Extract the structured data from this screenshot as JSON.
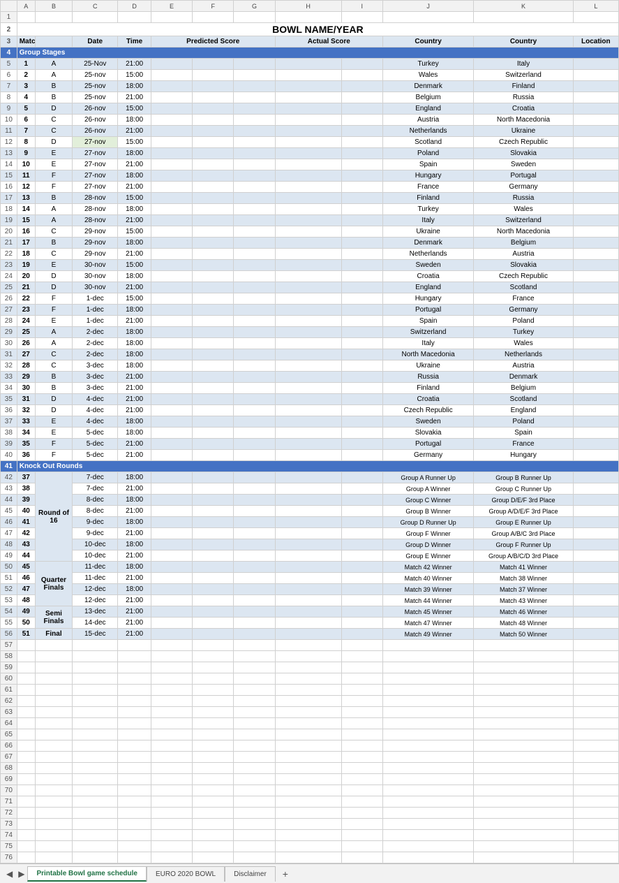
{
  "title": "BOWL NAME/YEAR",
  "columns": [
    "",
    "A",
    "B",
    "C",
    "D",
    "E",
    "F",
    "G",
    "H",
    "I",
    "J",
    "K",
    "L"
  ],
  "header_row": {
    "match_num": "Match #",
    "col_b": "",
    "date": "Date",
    "time": "Time",
    "predicted": "Predicted Score",
    "col_f": "",
    "col_g": "",
    "actual": "Actual Score",
    "col_i": "",
    "country1": "Country",
    "country2": "Country",
    "location": "Location"
  },
  "group_stages_label": "Group Stages",
  "group_matches": [
    {
      "num": "1",
      "grp": "A",
      "date": "25-Nov",
      "time": "21:00",
      "c1": "Turkey",
      "c2": "Italy"
    },
    {
      "num": "2",
      "grp": "A",
      "date": "25-nov",
      "time": "15:00",
      "c1": "Wales",
      "c2": "Switzerland"
    },
    {
      "num": "3",
      "grp": "B",
      "date": "25-nov",
      "time": "18:00",
      "c1": "Denmark",
      "c2": "Finland"
    },
    {
      "num": "4",
      "grp": "B",
      "date": "25-nov",
      "time": "21:00",
      "c1": "Belgium",
      "c2": "Russia"
    },
    {
      "num": "5",
      "grp": "D",
      "date": "26-nov",
      "time": "15:00",
      "c1": "England",
      "c2": "Croatia"
    },
    {
      "num": "6",
      "grp": "C",
      "date": "26-nov",
      "time": "18:00",
      "c1": "Austria",
      "c2": "North Macedonia"
    },
    {
      "num": "7",
      "grp": "C",
      "date": "26-nov",
      "time": "21:00",
      "c1": "Netherlands",
      "c2": "Ukraine"
    },
    {
      "num": "8",
      "grp": "D",
      "date": "27-nov",
      "time": "15:00",
      "c1": "Scotland",
      "c2": "Czech Republic",
      "green": true
    },
    {
      "num": "9",
      "grp": "E",
      "date": "27-nov",
      "time": "18:00",
      "c1": "Poland",
      "c2": "Slovakia"
    },
    {
      "num": "10",
      "grp": "E",
      "date": "27-nov",
      "time": "21:00",
      "c1": "Spain",
      "c2": "Sweden"
    },
    {
      "num": "11",
      "grp": "F",
      "date": "27-nov",
      "time": "18:00",
      "c1": "Hungary",
      "c2": "Portugal"
    },
    {
      "num": "12",
      "grp": "F",
      "date": "27-nov",
      "time": "21:00",
      "c1": "France",
      "c2": "Germany"
    },
    {
      "num": "13",
      "grp": "B",
      "date": "28-nov",
      "time": "15:00",
      "c1": "Finland",
      "c2": "Russia"
    },
    {
      "num": "14",
      "grp": "A",
      "date": "28-nov",
      "time": "18:00",
      "c1": "Turkey",
      "c2": "Wales"
    },
    {
      "num": "15",
      "grp": "A",
      "date": "28-nov",
      "time": "21:00",
      "c1": "Italy",
      "c2": "Switzerland"
    },
    {
      "num": "16",
      "grp": "C",
      "date": "29-nov",
      "time": "15:00",
      "c1": "Ukraine",
      "c2": "North Macedonia"
    },
    {
      "num": "17",
      "grp": "B",
      "date": "29-nov",
      "time": "18:00",
      "c1": "Denmark",
      "c2": "Belgium"
    },
    {
      "num": "18",
      "grp": "C",
      "date": "29-nov",
      "time": "21:00",
      "c1": "Netherlands",
      "c2": "Austria"
    },
    {
      "num": "19",
      "grp": "E",
      "date": "30-nov",
      "time": "15:00",
      "c1": "Sweden",
      "c2": "Slovakia"
    },
    {
      "num": "20",
      "grp": "D",
      "date": "30-nov",
      "time": "18:00",
      "c1": "Croatia",
      "c2": "Czech Republic"
    },
    {
      "num": "21",
      "grp": "D",
      "date": "30-nov",
      "time": "21:00",
      "c1": "England",
      "c2": "Scotland"
    },
    {
      "num": "22",
      "grp": "F",
      "date": "1-dec",
      "time": "15:00",
      "c1": "Hungary",
      "c2": "France"
    },
    {
      "num": "23",
      "grp": "F",
      "date": "1-dec",
      "time": "18:00",
      "c1": "Portugal",
      "c2": "Germany"
    },
    {
      "num": "24",
      "grp": "E",
      "date": "1-dec",
      "time": "21:00",
      "c1": "Spain",
      "c2": "Poland"
    },
    {
      "num": "25",
      "grp": "A",
      "date": "2-dec",
      "time": "18:00",
      "c1": "Switzerland",
      "c2": "Turkey"
    },
    {
      "num": "26",
      "grp": "A",
      "date": "2-dec",
      "time": "18:00",
      "c1": "Italy",
      "c2": "Wales"
    },
    {
      "num": "27",
      "grp": "C",
      "date": "2-dec",
      "time": "18:00",
      "c1": "North Macedonia",
      "c2": "Netherlands"
    },
    {
      "num": "28",
      "grp": "C",
      "date": "3-dec",
      "time": "18:00",
      "c1": "Ukraine",
      "c2": "Austria"
    },
    {
      "num": "29",
      "grp": "B",
      "date": "3-dec",
      "time": "21:00",
      "c1": "Russia",
      "c2": "Denmark"
    },
    {
      "num": "30",
      "grp": "B",
      "date": "3-dec",
      "time": "21:00",
      "c1": "Finland",
      "c2": "Belgium"
    },
    {
      "num": "31",
      "grp": "D",
      "date": "4-dec",
      "time": "21:00",
      "c1": "Croatia",
      "c2": "Scotland"
    },
    {
      "num": "32",
      "grp": "D",
      "date": "4-dec",
      "time": "21:00",
      "c1": "Czech Republic",
      "c2": "England"
    },
    {
      "num": "33",
      "grp": "E",
      "date": "4-dec",
      "time": "18:00",
      "c1": "Sweden",
      "c2": "Poland"
    },
    {
      "num": "34",
      "grp": "E",
      "date": "5-dec",
      "time": "18:00",
      "c1": "Slovakia",
      "c2": "Spain"
    },
    {
      "num": "35",
      "grp": "F",
      "date": "5-dec",
      "time": "21:00",
      "c1": "Portugal",
      "c2": "France"
    },
    {
      "num": "36",
      "grp": "F",
      "date": "5-dec",
      "time": "21:00",
      "c1": "Germany",
      "c2": "Hungary"
    }
  ],
  "ko_label": "Knock Out Rounds",
  "ko_matches": [
    {
      "num": "37",
      "round": "",
      "date": "7-dec",
      "time": "18:00",
      "c1": "Group A Runner Up",
      "c2": "Group B Runner Up"
    },
    {
      "num": "38",
      "round": "",
      "date": "7-dec",
      "time": "21:00",
      "c1": "Group A Winner",
      "c2": "Group C Runner Up"
    },
    {
      "num": "39",
      "round": "",
      "date": "8-dec",
      "time": "18:00",
      "c1": "Group C Winner",
      "c2": "Group D/E/F 3rd Place"
    },
    {
      "num": "40",
      "round": "Round of 16",
      "date": "8-dec",
      "time": "21:00",
      "c1": "Group B Winner",
      "c2": "Group A/D/E/F 3rd Place"
    },
    {
      "num": "41",
      "round": "",
      "date": "9-dec",
      "time": "18:00",
      "c1": "Group D Runner Up",
      "c2": "Group E Runner Up"
    },
    {
      "num": "42",
      "round": "",
      "date": "9-dec",
      "time": "21:00",
      "c1": "Group F Winner",
      "c2": "Group A/B/C 3rd Place"
    },
    {
      "num": "43",
      "round": "",
      "date": "10-dec",
      "time": "18:00",
      "c1": "Group D Winner",
      "c2": "Group F Runner Up"
    },
    {
      "num": "44",
      "round": "",
      "date": "10-dec",
      "time": "21:00",
      "c1": "Group E Winner",
      "c2": "Group A/B/C/D 3rd Place"
    },
    {
      "num": "45",
      "round": "",
      "date": "11-dec",
      "time": "18:00",
      "c1": "Match 42 Winner",
      "c2": "Match 41 Winner"
    },
    {
      "num": "46",
      "round": "Quarter Finals",
      "date": "11-dec",
      "time": "21:00",
      "c1": "Match 40 Winner",
      "c2": "Match 38 Winner"
    },
    {
      "num": "47",
      "round": "",
      "date": "12-dec",
      "time": "18:00",
      "c1": "Match 39 Winner",
      "c2": "Match 37 Winner"
    },
    {
      "num": "48",
      "round": "",
      "date": "12-dec",
      "time": "21:00",
      "c1": "Match 44 Winner",
      "c2": "Match 43 Winner"
    },
    {
      "num": "49",
      "round": "Semi Finals",
      "date": "13-dec",
      "time": "21:00",
      "c1": "Match 45 Winner",
      "c2": "Match 46 Winner"
    },
    {
      "num": "50",
      "round": "",
      "date": "14-dec",
      "time": "21:00",
      "c1": "Match 47 Winner",
      "c2": "Match 48 Winner"
    },
    {
      "num": "51",
      "round": "Final",
      "date": "15-dec",
      "time": "21:00",
      "c1": "Match 49 Winner",
      "c2": "Match 50 Winner"
    }
  ],
  "tabs": [
    {
      "label": "Printable Bowl game schedule",
      "active": true
    },
    {
      "label": "EURO 2020 BOWL",
      "active": false
    },
    {
      "label": "Disclaimer",
      "active": false
    }
  ],
  "tab_add": "+"
}
